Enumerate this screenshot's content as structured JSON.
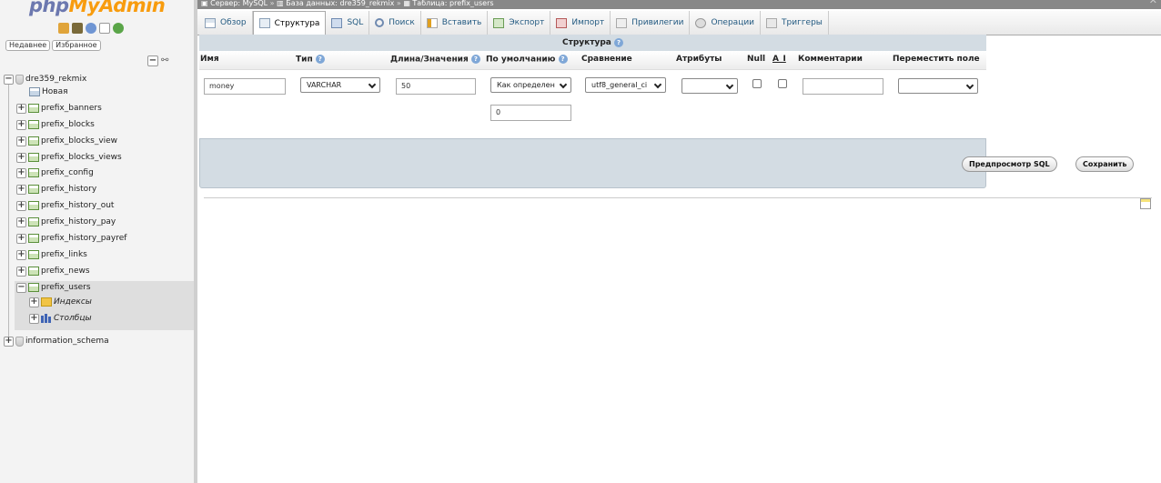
{
  "nav": {
    "logo_php": "php",
    "logo_myadmin": "MyAdmin",
    "recent_label": "Недавнее",
    "favorites_label": "Избранное",
    "databases": [
      {
        "name": "dre359_rekmix"
      },
      {
        "name": "information_schema"
      }
    ],
    "new_label": "Новая",
    "tables": [
      "prefix_banners",
      "prefix_blocks",
      "prefix_blocks_view",
      "prefix_blocks_views",
      "prefix_config",
      "prefix_history",
      "prefix_history_out",
      "prefix_history_pay",
      "prefix_history_payref",
      "prefix_links",
      "prefix_news",
      "prefix_users"
    ],
    "selected_table": "prefix_users",
    "indexes_label": "Индексы",
    "columns_label": "Столбцы",
    "icon_names": [
      "home-icon",
      "exit-icon",
      "help-icon",
      "docs-icon",
      "reload-icon",
      "collapse-all-icon",
      "link-icon"
    ]
  },
  "breadcrumb": {
    "server": "Сервер: MySQL",
    "database": "База данных: dre359_rekmix",
    "table": "Таблица: prefix_users",
    "separator": "»"
  },
  "tabs": [
    {
      "label": "Обзор",
      "icon": "browse-icon",
      "active": false
    },
    {
      "label": "Структура",
      "icon": "structure-icon",
      "active": true
    },
    {
      "label": "SQL",
      "icon": "sql-icon",
      "active": false
    },
    {
      "label": "Поиск",
      "icon": "search-icon",
      "active": false
    },
    {
      "label": "Вставить",
      "icon": "insert-icon",
      "active": false
    },
    {
      "label": "Экспорт",
      "icon": "export-icon",
      "active": false
    },
    {
      "label": "Импорт",
      "icon": "import-icon",
      "active": false
    },
    {
      "label": "Привилегии",
      "icon": "privileges-icon",
      "active": false
    },
    {
      "label": "Операции",
      "icon": "operations-icon",
      "active": false
    },
    {
      "label": "Триггеры",
      "icon": "triggers-icon",
      "active": false
    }
  ],
  "form": {
    "caption": "Структура",
    "headers": {
      "name": "Имя",
      "type": "Тип",
      "length": "Длина/Значения",
      "default": "По умолчанию",
      "collation": "Сравнение",
      "attributes": "Атрибуты",
      "null": "Null",
      "ai": "A_I",
      "comments": "Комментарии",
      "move": "Переместить поле"
    },
    "row": {
      "name_value": "money",
      "type_value": "VARCHAR",
      "length_value": "50",
      "default_value": "Как определен",
      "default_input": "0",
      "collation_value": "utf8_general_ci",
      "attributes_value": "",
      "null_checked": false,
      "ai_checked": false,
      "comments_value": "",
      "move_value": ""
    },
    "preview_button": "Предпросмотр SQL",
    "save_button": "Сохранить"
  },
  "colors": {
    "accent_blue": "#235a81",
    "logo_php": "#6c78af",
    "logo_myadmin": "#f89c0e",
    "form_bar": "#d3dce3"
  }
}
